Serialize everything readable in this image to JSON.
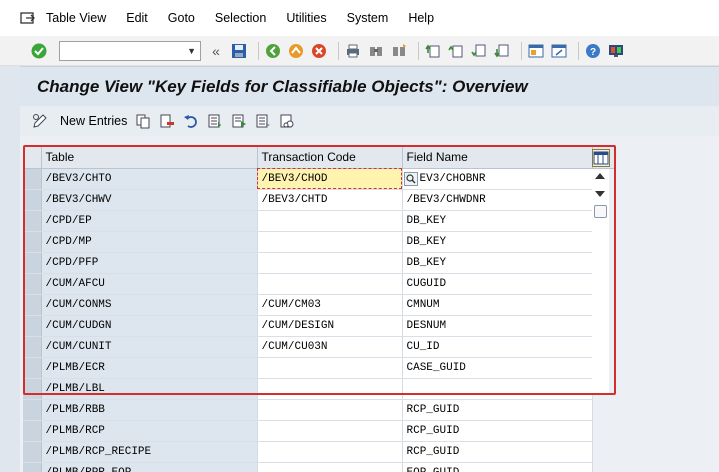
{
  "menubar": {
    "items": [
      "Table View",
      "Edit",
      "Goto",
      "Selection",
      "Utilities",
      "System",
      "Help"
    ]
  },
  "toolbar": {
    "command_field": "",
    "icons": [
      "enter-icon",
      "save-icon",
      "back-icon",
      "exit-icon",
      "cancel-icon",
      "print-icon",
      "find-icon",
      "find-next-icon",
      "first-page-icon",
      "previous-page-icon",
      "next-page-icon",
      "last-page-icon",
      "new-session-icon",
      "shortcut-icon",
      "help-icon",
      "customize-layout-icon"
    ]
  },
  "header": {
    "title": "Change View \"Key Fields for Classifiable Objects\": Overview"
  },
  "app_toolbar": {
    "new_entries_label": "New Entries"
  },
  "table": {
    "columns": [
      "Table",
      "Transaction Code",
      "Field Name"
    ],
    "rows": [
      [
        "/BEV3/CHTO",
        "/BEV3/CHOD",
        "/BEV3/CHOBNR"
      ],
      [
        "/BEV3/CHWV",
        "/BEV3/CHTD",
        "/BEV3/CHWDNR"
      ],
      [
        "/CPD/EP",
        "",
        "DB_KEY"
      ],
      [
        "/CPD/MP",
        "",
        "DB_KEY"
      ],
      [
        "/CPD/PFP",
        "",
        "DB_KEY"
      ],
      [
        "/CUM/AFCU",
        "",
        "CUGUID"
      ],
      [
        "/CUM/CONMS",
        "/CUM/CM03",
        "CMNUM"
      ],
      [
        "/CUM/CUDGN",
        "/CUM/DESIGN",
        "DESNUM"
      ],
      [
        "/CUM/CUNIT",
        "/CUM/CU03N",
        "CU_ID"
      ],
      [
        "/PLMB/ECR",
        "",
        "CASE_GUID"
      ],
      [
        "/PLMB/LBL",
        "",
        ""
      ],
      [
        "/PLMB/RBB",
        "",
        "RCP_GUID"
      ],
      [
        "/PLMB/RCP",
        "",
        "RCP_GUID"
      ],
      [
        "/PLMB/RCP_RECIPE",
        "",
        "RCP_GUID"
      ],
      [
        "/PLMB/RPR_EOP",
        "",
        "EOP_GUID"
      ]
    ],
    "first_row_field_visible": "EV3/CHOBNR"
  },
  "colors": {
    "highlight_frame": "#d42d2d",
    "focus_cell": "#fff3b0"
  }
}
